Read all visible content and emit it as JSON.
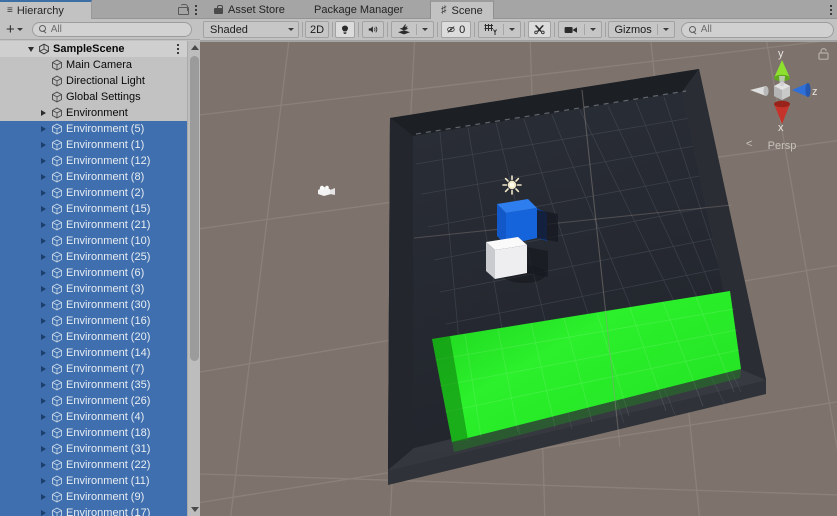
{
  "hierarchy": {
    "tab_label": "Hierarchy",
    "tab_icon": "hierarchy-icon",
    "lock_icon": "lock-icon",
    "menu_icon": "kebab-menu-icon",
    "create_label": "+",
    "search_placeholder": "All",
    "search_value": "",
    "scene": {
      "label": "SampleScene",
      "expanded": true
    },
    "items": [
      {
        "label": "Main Camera",
        "depth": 2,
        "expandable": false,
        "selected": false
      },
      {
        "label": "Directional Light",
        "depth": 2,
        "expandable": false,
        "selected": false
      },
      {
        "label": "Global Settings",
        "depth": 2,
        "expandable": false,
        "selected": false
      },
      {
        "label": "Environment",
        "depth": 2,
        "expandable": true,
        "selected": false
      },
      {
        "label": "Environment (5)",
        "depth": 2,
        "expandable": true,
        "selected": true
      },
      {
        "label": "Environment (1)",
        "depth": 2,
        "expandable": true,
        "selected": true
      },
      {
        "label": "Environment (12)",
        "depth": 2,
        "expandable": true,
        "selected": true
      },
      {
        "label": "Environment (8)",
        "depth": 2,
        "expandable": true,
        "selected": true
      },
      {
        "label": "Environment (2)",
        "depth": 2,
        "expandable": true,
        "selected": true
      },
      {
        "label": "Environment (15)",
        "depth": 2,
        "expandable": true,
        "selected": true
      },
      {
        "label": "Environment (21)",
        "depth": 2,
        "expandable": true,
        "selected": true
      },
      {
        "label": "Environment (10)",
        "depth": 2,
        "expandable": true,
        "selected": true
      },
      {
        "label": "Environment (25)",
        "depth": 2,
        "expandable": true,
        "selected": true
      },
      {
        "label": "Environment (6)",
        "depth": 2,
        "expandable": true,
        "selected": true
      },
      {
        "label": "Environment (3)",
        "depth": 2,
        "expandable": true,
        "selected": true
      },
      {
        "label": "Environment (30)",
        "depth": 2,
        "expandable": true,
        "selected": true
      },
      {
        "label": "Environment (16)",
        "depth": 2,
        "expandable": true,
        "selected": true
      },
      {
        "label": "Environment (20)",
        "depth": 2,
        "expandable": true,
        "selected": true
      },
      {
        "label": "Environment (14)",
        "depth": 2,
        "expandable": true,
        "selected": true
      },
      {
        "label": "Environment (7)",
        "depth": 2,
        "expandable": true,
        "selected": true
      },
      {
        "label": "Environment (35)",
        "depth": 2,
        "expandable": true,
        "selected": true
      },
      {
        "label": "Environment (26)",
        "depth": 2,
        "expandable": true,
        "selected": true
      },
      {
        "label": "Environment (4)",
        "depth": 2,
        "expandable": true,
        "selected": true
      },
      {
        "label": "Environment (18)",
        "depth": 2,
        "expandable": true,
        "selected": true
      },
      {
        "label": "Environment (31)",
        "depth": 2,
        "expandable": true,
        "selected": true
      },
      {
        "label": "Environment (22)",
        "depth": 2,
        "expandable": true,
        "selected": true
      },
      {
        "label": "Environment (11)",
        "depth": 2,
        "expandable": true,
        "selected": true
      },
      {
        "label": "Environment (9)",
        "depth": 2,
        "expandable": true,
        "selected": true
      },
      {
        "label": "Environment (17)",
        "depth": 2,
        "expandable": true,
        "selected": true
      }
    ]
  },
  "editor_tabs": [
    {
      "label": "Asset Store",
      "icon": "asset-store-icon",
      "active": false
    },
    {
      "label": "Package Manager",
      "icon": "",
      "active": false
    },
    {
      "label": "Scene",
      "icon": "scene-grid-icon",
      "active": true
    }
  ],
  "scene_toolbar": {
    "draw_mode": "Shaded",
    "two_d_label": "2D",
    "lighting_icon": "lightbulb-icon",
    "audio_icon": "speaker-icon",
    "fx_icon": "effects-layers-icon",
    "fx_caret": "chevron-down-icon",
    "hidden_objects_icon": "eye-slash-icon",
    "hidden_objects_count": "0",
    "grid_icon": "grid-snap-icon",
    "grid_caret": "chevron-down-icon",
    "tools_icon": "tools-icon",
    "camera_icon": "scene-camera-icon",
    "camera_caret": "chevron-down-icon",
    "gizmos_label": "Gizmos",
    "gizmos_caret": "chevron-down-icon",
    "search_placeholder": "All",
    "search_value": "",
    "menu_icon": "kebab-menu-icon"
  },
  "view_gizmo": {
    "axis_x": "x",
    "axis_y": "y",
    "axis_z": "z",
    "projection": "Persp",
    "lock_icon": "lock-icon",
    "colors": {
      "x": "#c03a2b",
      "y": "#6fd22b",
      "z": "#2f6fd8",
      "neutral": "#d8d8d8"
    }
  },
  "scene_content": {
    "background_color": "#7d736c",
    "grid_line_color": "#8e847c",
    "arena_wall_color": "#3a3d44",
    "arena_floor_color": "#262a33",
    "goal_color": "#22dd22",
    "agent_cube_color": "#1464dc",
    "target_cube_color": "#f2f2f2",
    "light_gizmo": "directional-light-gizmo",
    "camera_gizmo": "camera-gizmo"
  }
}
